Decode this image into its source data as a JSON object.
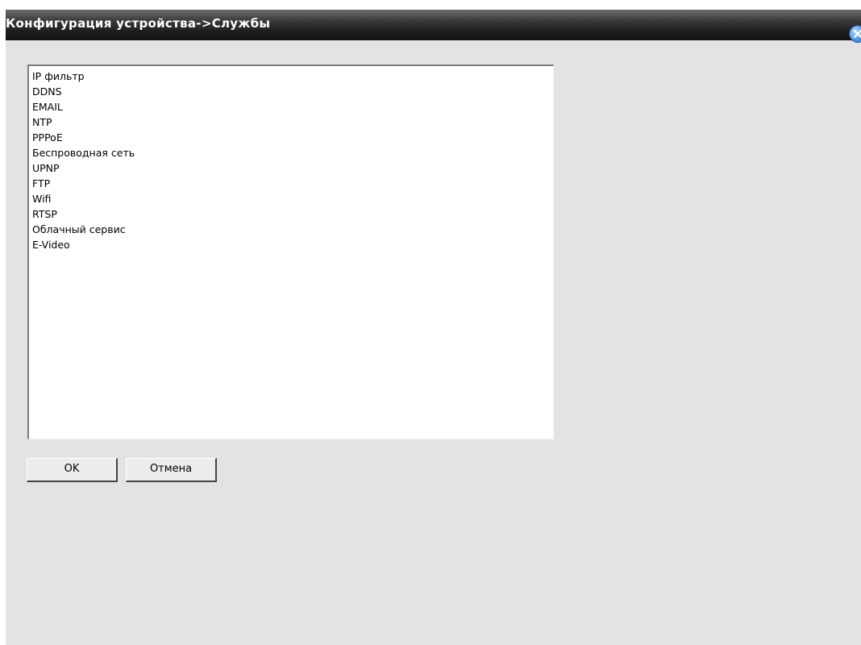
{
  "window": {
    "title": "Конфигурация устройства->Службы",
    "close_icon": "close-icon"
  },
  "services_list": {
    "items": [
      "IP фильтр",
      "DDNS",
      "EMAIL",
      "NTP",
      "PPPoE",
      "Беспроводная сеть",
      "UPNP",
      "FTP",
      "Wifi",
      "RTSP",
      "Облачный сервис",
      "E-Video"
    ]
  },
  "buttons": {
    "ok_label": "OK",
    "cancel_label": "Отмена"
  }
}
